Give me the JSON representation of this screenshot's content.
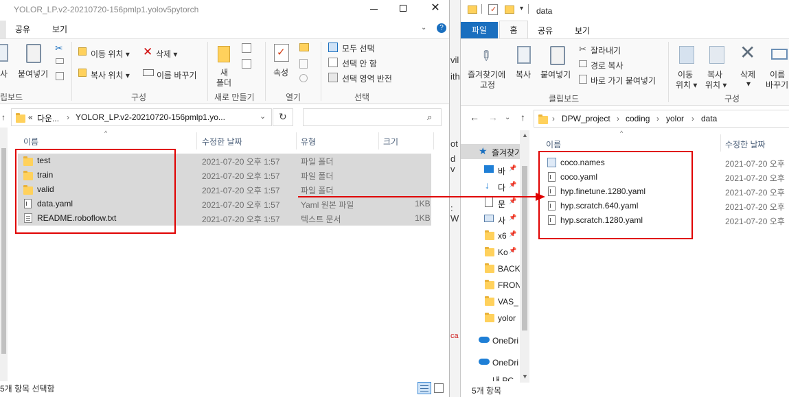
{
  "left": {
    "title": "YOLOR_LP.v2-20210720-156pmlp1.yolov5pytorch",
    "tabs": [
      "공유",
      "보기"
    ],
    "ribbon": {
      "clipboard_cut_partial": "사",
      "paste": "붙여넣기",
      "clipboard_group_partial": "립보드",
      "move_to": "이동 위치 ▾",
      "copy_to": "복사 위치 ▾",
      "delete": "삭제 ▾",
      "rename": "이름 바꾸기",
      "organize_group": "구성",
      "new_folder_line1": "새",
      "new_folder_line2": "폴더",
      "new_group": "새로 만들기",
      "properties": "속성",
      "open_group": "열기",
      "select_all": "모두 선택",
      "select_none": "선택 안 함",
      "invert_selection": "선택 영역 반전",
      "select_group": "선택"
    },
    "address": {
      "prefix": "«",
      "crumbs": [
        "다운...",
        "YOLOR_LP.v2-20210720-156pmlp1.yo..."
      ]
    },
    "columns": [
      "이름",
      "수정한 날짜",
      "유형",
      "크기"
    ],
    "files": [
      {
        "name": "test",
        "date": "2021-07-20 오후 1:57",
        "type": "파일 폴더",
        "size": ""
      },
      {
        "name": "train",
        "date": "2021-07-20 오후 1:57",
        "type": "파일 폴더",
        "size": ""
      },
      {
        "name": "valid",
        "date": "2021-07-20 오후 1:57",
        "type": "파일 폴더",
        "size": ""
      },
      {
        "name": "data.yaml",
        "date": "2021-07-20 오후 1:57",
        "type": "Yaml 원본 파일",
        "size": "1KB"
      },
      {
        "name": "README.roboflow.txt",
        "date": "2021-07-20 오후 1:57",
        "type": "텍스트 문서",
        "size": "1KB"
      }
    ],
    "status": "5개 항목 선택함"
  },
  "gap_fragments": [
    "vil",
    "ith",
    "ot",
    "d v",
    ": W",
    "ca"
  ],
  "right": {
    "title": "data",
    "tabs": [
      "파일",
      "홈",
      "공유",
      "보기"
    ],
    "ribbon": {
      "pin_line1": "즐겨찾기에",
      "pin_line2": "고정",
      "copy": "복사",
      "paste": "붙여넣기",
      "cut": "잘라내기",
      "copy_path": "경로 복사",
      "paste_shortcut": "바로 가기 붙여넣기",
      "clipboard_group": "클립보드",
      "move_to_line1": "이동",
      "move_to_line2": "위치 ▾",
      "copy_to_line1": "복사",
      "copy_to_line2": "위치 ▾",
      "delete": "삭제",
      "delete_arrow": "▾",
      "rename_line1": "이름",
      "rename_line2": "바꾸기",
      "organize_group": "구성"
    },
    "address": {
      "crumbs": [
        "DPW_project",
        "coding",
        "yolor",
        "data"
      ]
    },
    "columns": [
      "이름",
      "수정한 날짜"
    ],
    "nav": [
      {
        "label": "즐겨찾기"
      },
      {
        "label": "바"
      },
      {
        "label": "다"
      },
      {
        "label": "문"
      },
      {
        "label": "사"
      },
      {
        "label": "x6"
      },
      {
        "label": "Ko"
      },
      {
        "label": "BACK"
      },
      {
        "label": "FRON"
      },
      {
        "label": "VAS_"
      },
      {
        "label": "yolor"
      },
      {
        "label": "OneDri"
      },
      {
        "label": "OneDri"
      },
      {
        "label": "내 PC"
      }
    ],
    "files": [
      {
        "name": "coco.names",
        "date": "2021-07-20 오후"
      },
      {
        "name": "coco.yaml",
        "date": "2021-07-20 오후"
      },
      {
        "name": "hyp.finetune.1280.yaml",
        "date": "2021-07-20 오후"
      },
      {
        "name": "hyp.scratch.640.yaml",
        "date": "2021-07-20 오후"
      },
      {
        "name": "hyp.scratch.1280.yaml",
        "date": "2021-07-20 오후"
      }
    ],
    "status": "5개 항목"
  },
  "colors": {
    "annotation": "#e00000",
    "selection": "#d9d9d9",
    "file_tab": "#1a6fbf",
    "folder": "#ffd15c"
  },
  "icons": [
    "minimize-icon",
    "maximize-icon",
    "close-icon",
    "help-icon",
    "chevron-down-icon",
    "refresh-icon",
    "search-icon",
    "back-arrow-icon",
    "forward-arrow-icon",
    "up-arrow-icon",
    "folder-icon",
    "file-icon",
    "pin-icon",
    "scissors-icon",
    "delete-x-icon",
    "checkmark-icon",
    "star-icon",
    "cloud-icon",
    "details-view-icon",
    "large-icons-view-icon"
  ]
}
